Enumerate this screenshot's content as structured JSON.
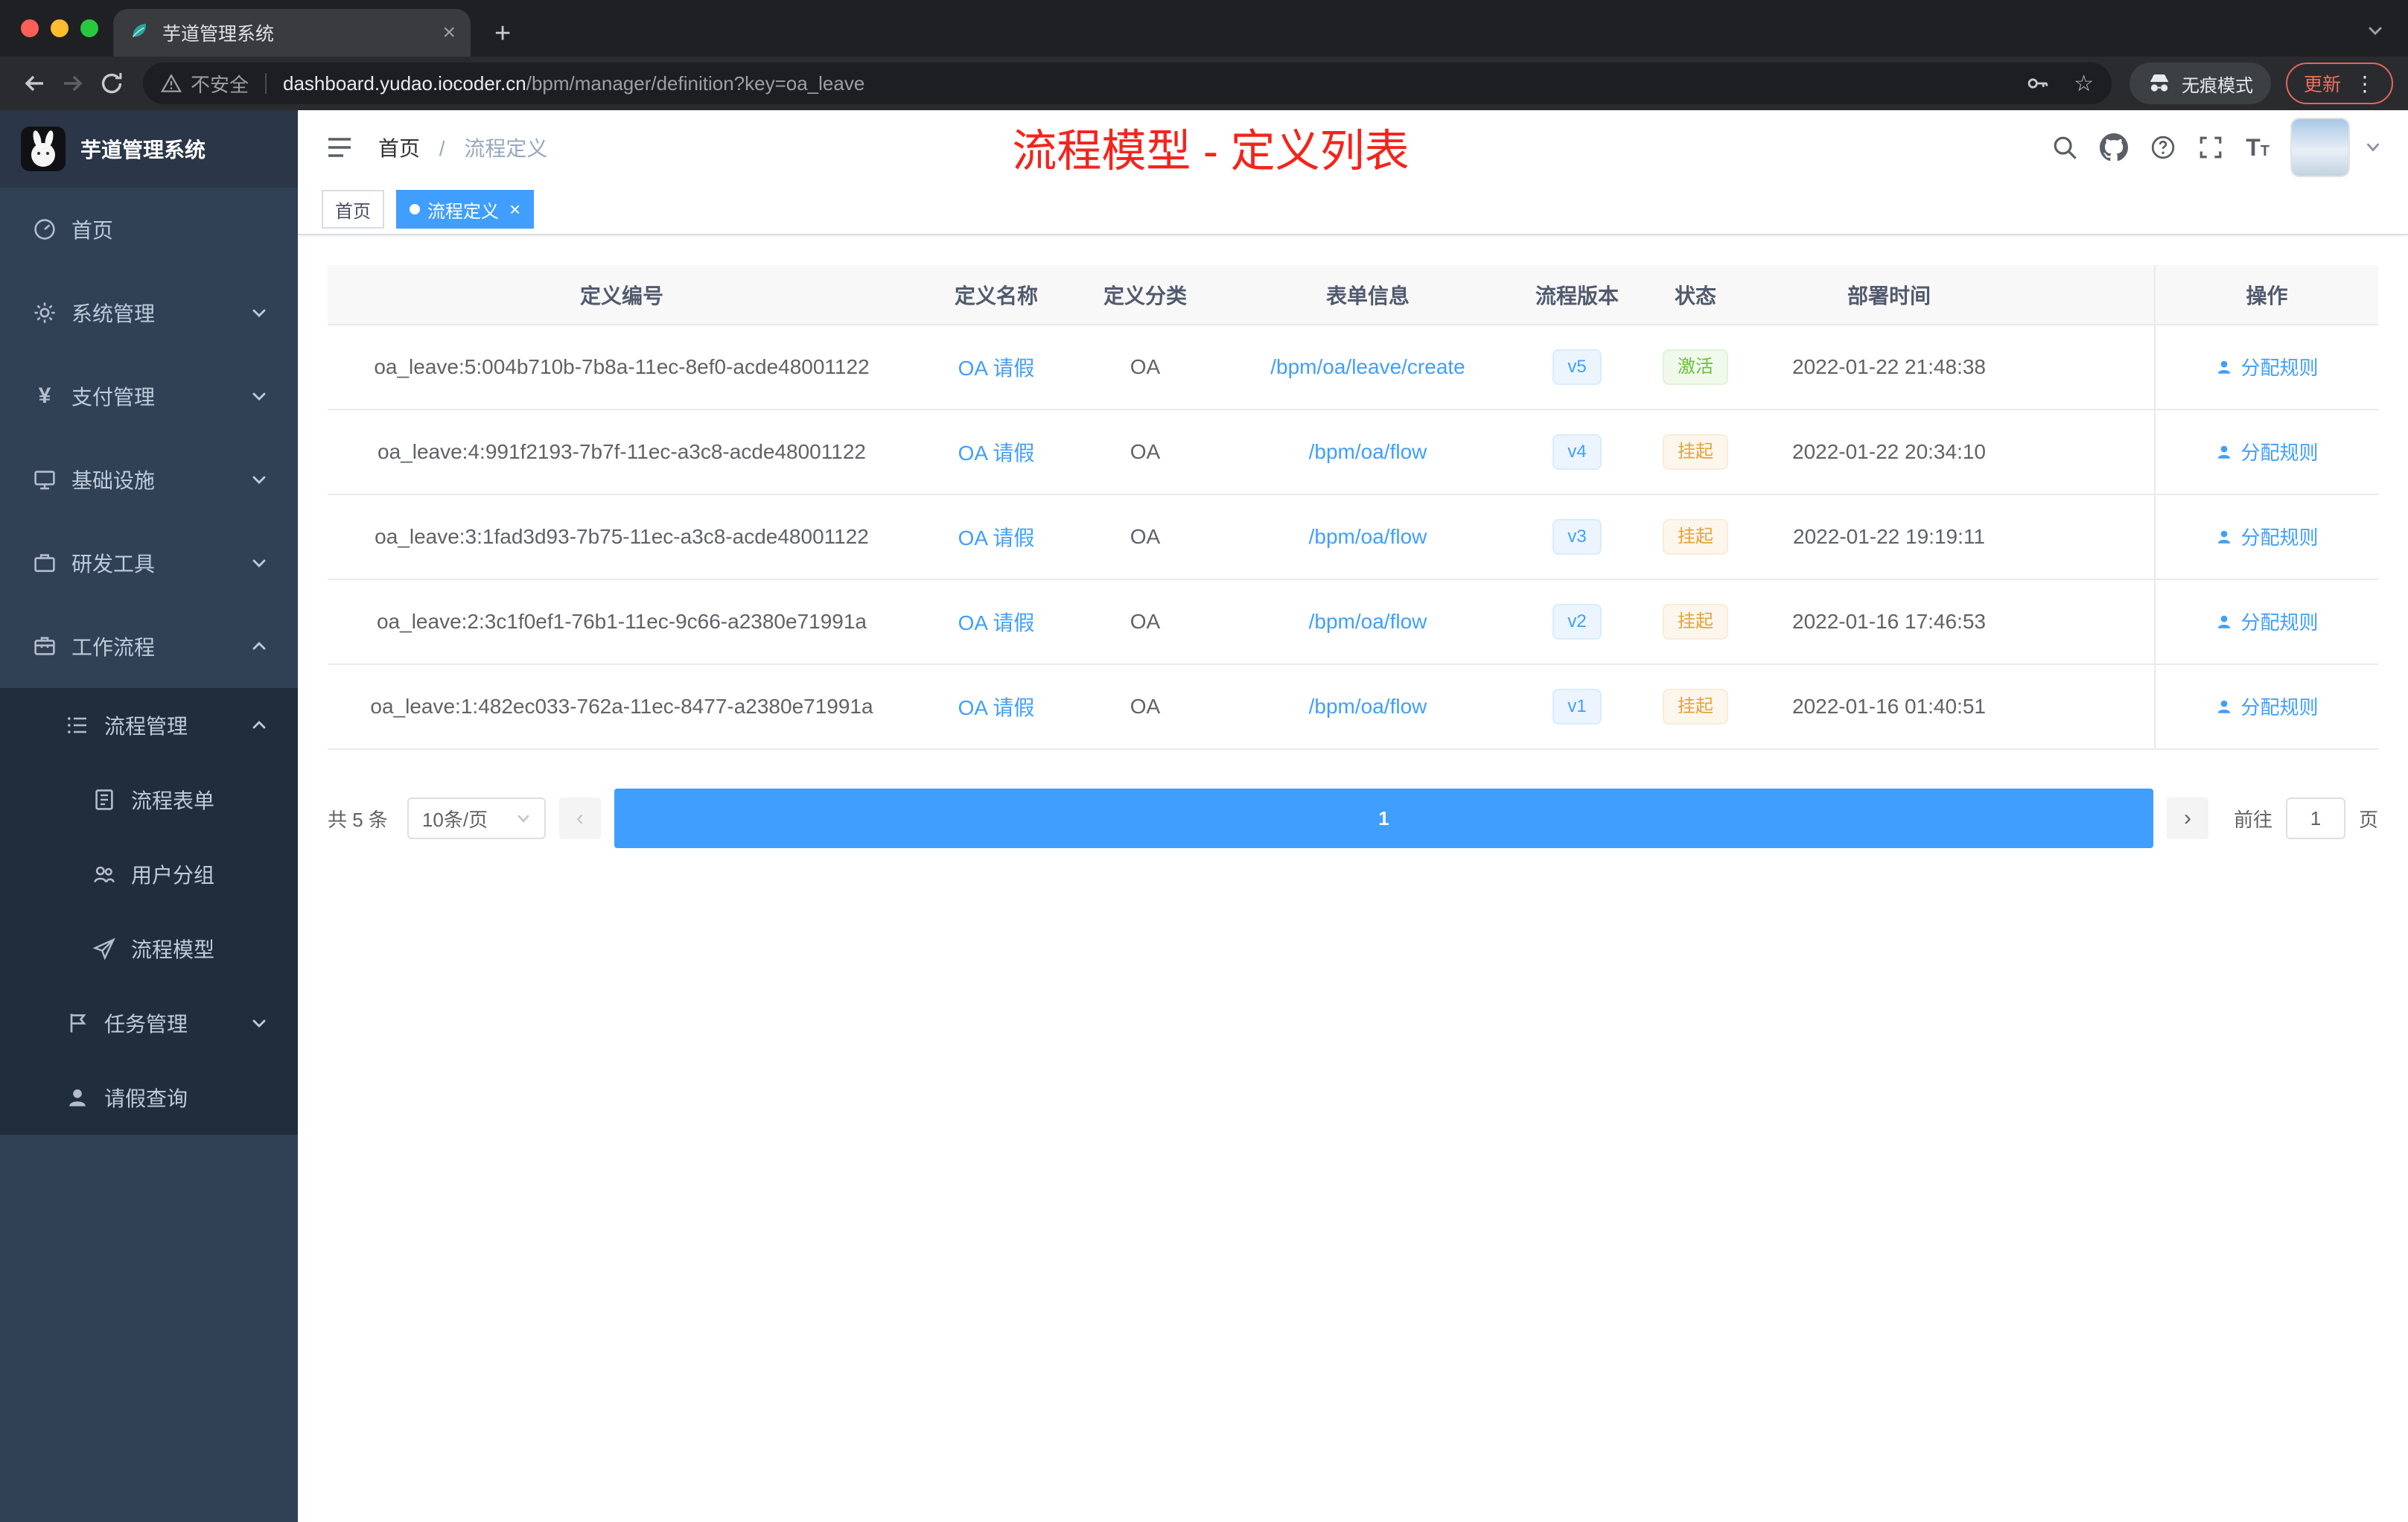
{
  "colors": {
    "accent": "#409eff",
    "annotation_red": "#f5231b",
    "success": "#67c23a",
    "warning": "#e6a23c",
    "sidebar_bg": "#304156",
    "submenu_bg": "#1f2d3d"
  },
  "glyphs": {
    "close": "×",
    "plus": "+",
    "star": "☆",
    "dots": "⋮",
    "yen": "¥",
    "prev": "‹",
    "next": "›"
  },
  "browser": {
    "tab_title": "芋道管理系统",
    "security_label": "不安全",
    "url_domain": "dashboard.yudao.iocoder.cn",
    "url_path": "/bpm/manager/definition?key=oa_leave",
    "incognito_label": "无痕模式",
    "update_label": "更新"
  },
  "sidebar": {
    "logo_title": "芋道管理系统",
    "menu": [
      {
        "label": "首页"
      },
      {
        "label": "系统管理"
      },
      {
        "label": "支付管理"
      },
      {
        "label": "基础设施"
      },
      {
        "label": "研发工具"
      },
      {
        "label": "工作流程"
      },
      {
        "label": "流程管理"
      },
      {
        "label": "流程表单"
      },
      {
        "label": "用户分组"
      },
      {
        "label": "流程模型"
      },
      {
        "label": "任务管理"
      },
      {
        "label": "请假查询"
      }
    ]
  },
  "header": {
    "breadcrumb_home": "首页",
    "breadcrumb_sep": "/",
    "breadcrumb_current": "流程定义",
    "annotation": "流程模型 - 定义列表"
  },
  "tags": {
    "home": "首页",
    "current": "流程定义"
  },
  "table": {
    "columns": [
      "定义编号",
      "定义名称",
      "定义分类",
      "表单信息",
      "流程版本",
      "状态",
      "部署时间",
      "操作"
    ],
    "rows": [
      {
        "id": "oa_leave:5:004b710b-7b8a-11ec-8ef0-acde48001122",
        "name": "OA 请假",
        "category": "OA",
        "form": "/bpm/oa/leave/create",
        "version": "v5",
        "status": "激活",
        "time": "2022-01-22 21:48:38",
        "action": "分配规则"
      },
      {
        "id": "oa_leave:4:991f2193-7b7f-11ec-a3c8-acde48001122",
        "name": "OA 请假",
        "category": "OA",
        "form": "/bpm/oa/flow",
        "version": "v4",
        "status": "挂起",
        "time": "2022-01-22 20:34:10",
        "action": "分配规则"
      },
      {
        "id": "oa_leave:3:1fad3d93-7b75-11ec-a3c8-acde48001122",
        "name": "OA 请假",
        "category": "OA",
        "form": "/bpm/oa/flow",
        "version": "v3",
        "status": "挂起",
        "time": "2022-01-22 19:19:11",
        "action": "分配规则"
      },
      {
        "id": "oa_leave:2:3c1f0ef1-76b1-11ec-9c66-a2380e71991a",
        "name": "OA 请假",
        "category": "OA",
        "form": "/bpm/oa/flow",
        "version": "v2",
        "status": "挂起",
        "time": "2022-01-16 17:46:53",
        "action": "分配规则"
      },
      {
        "id": "oa_leave:1:482ec033-762a-11ec-8477-a2380e71991a",
        "name": "OA 请假",
        "category": "OA",
        "form": "/bpm/oa/flow",
        "version": "v1",
        "status": "挂起",
        "time": "2022-01-16 01:40:51",
        "action": "分配规则"
      }
    ]
  },
  "pagination": {
    "total": "共 5 条",
    "page_size": "10条/页",
    "page": "1",
    "goto": "前往",
    "goto_value": "1",
    "unit": "页"
  }
}
